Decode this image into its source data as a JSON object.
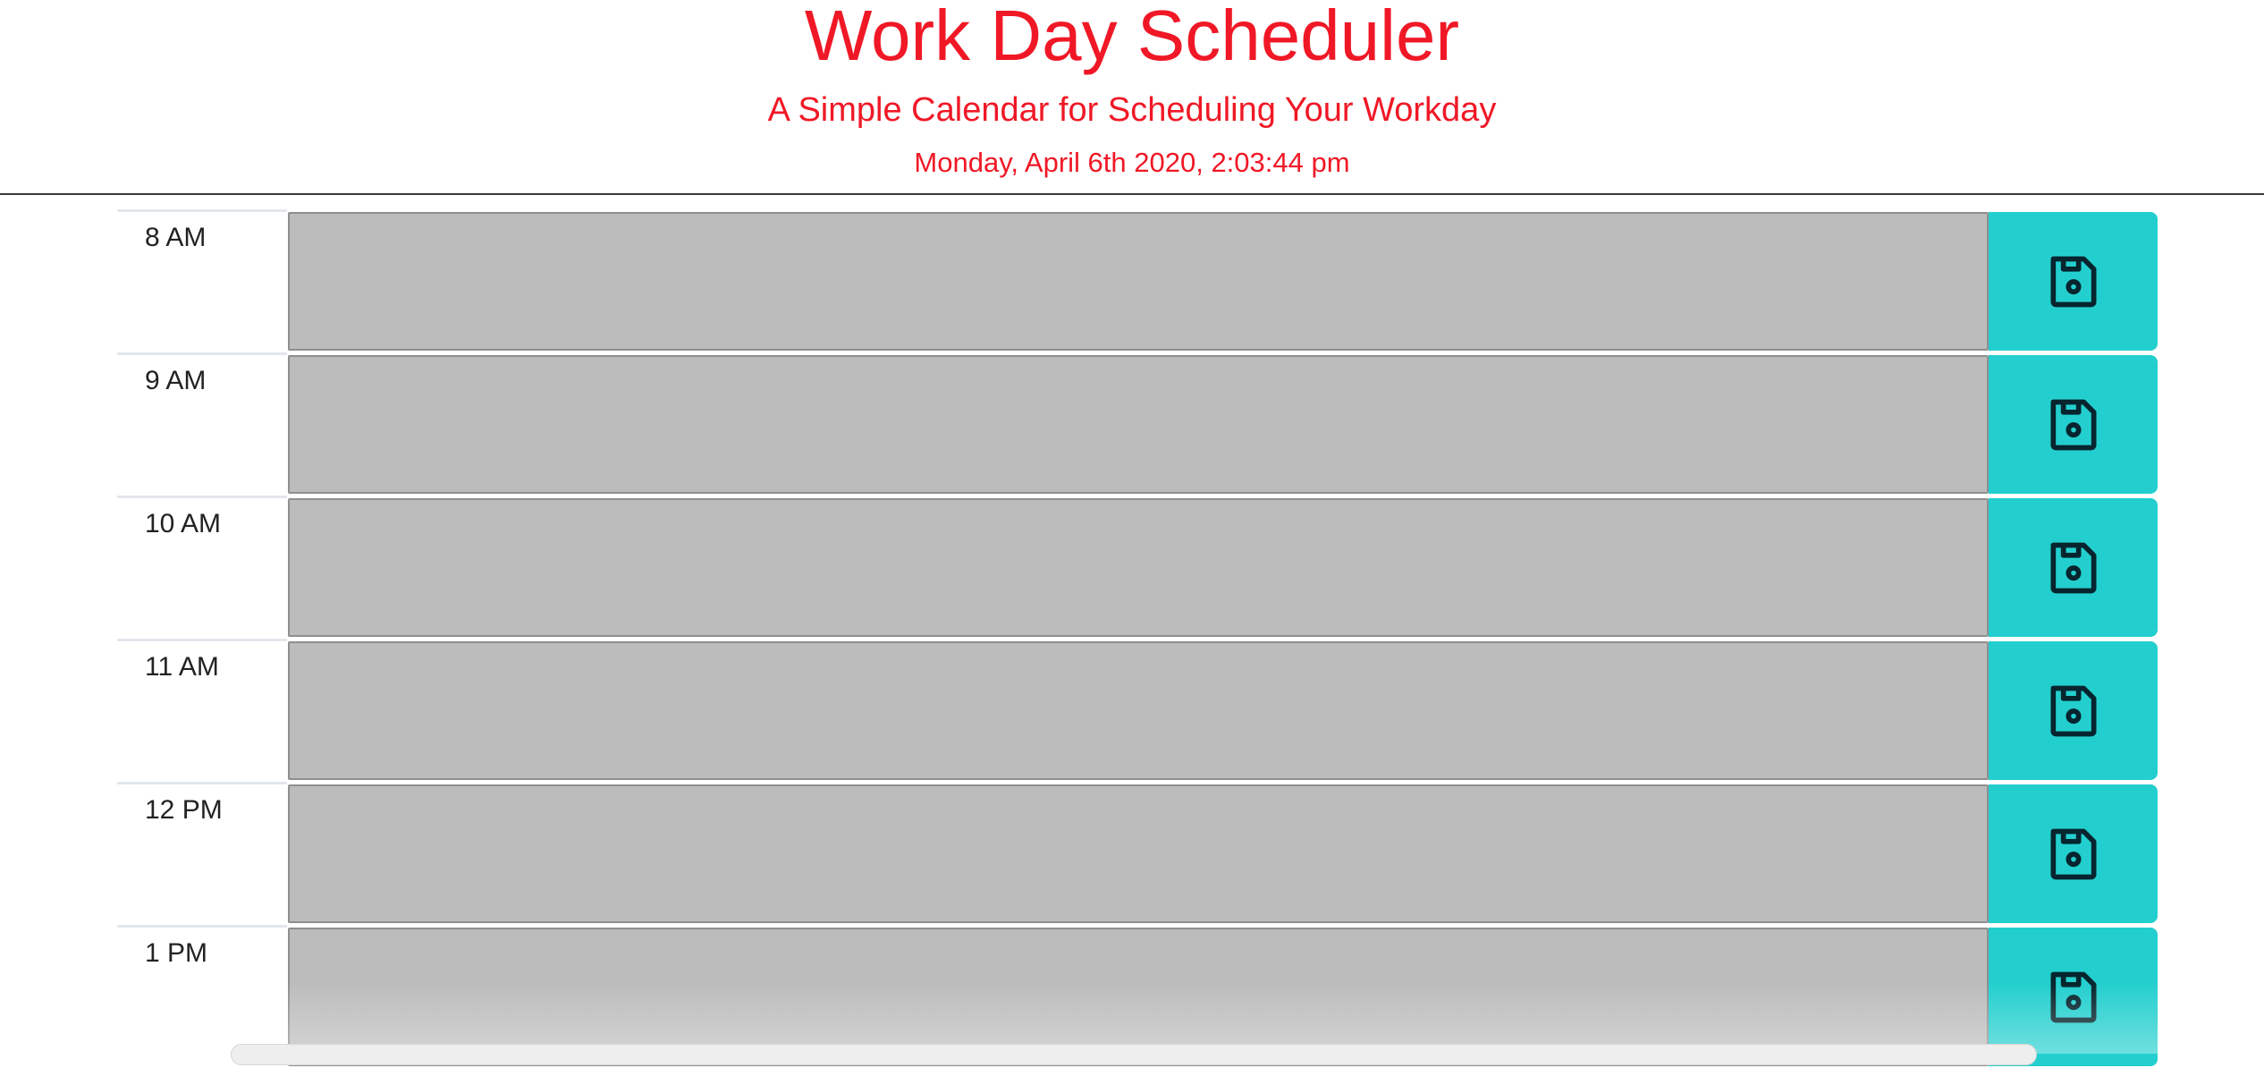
{
  "header": {
    "title": "Work Day Scheduler",
    "subtitle": "A Simple Calendar for Scheduling Your Workday",
    "current_date": "Monday, April 6th 2020, 2:03:44 pm"
  },
  "rows": [
    {
      "hour": "8 AM",
      "event_text": "",
      "save_icon": "floppy-disk-icon"
    },
    {
      "hour": "9 AM",
      "event_text": "",
      "save_icon": "floppy-disk-icon"
    },
    {
      "hour": "10 AM",
      "event_text": "",
      "save_icon": "floppy-disk-icon"
    },
    {
      "hour": "11 AM",
      "event_text": "",
      "save_icon": "floppy-disk-icon"
    },
    {
      "hour": "12 PM",
      "event_text": "",
      "save_icon": "floppy-disk-icon"
    },
    {
      "hour": "1 PM",
      "event_text": "",
      "save_icon": "floppy-disk-icon"
    }
  ],
  "colors": {
    "accent_text": "#f01826",
    "past_row": "#bcbcbc",
    "save_button": "#23cfce"
  }
}
